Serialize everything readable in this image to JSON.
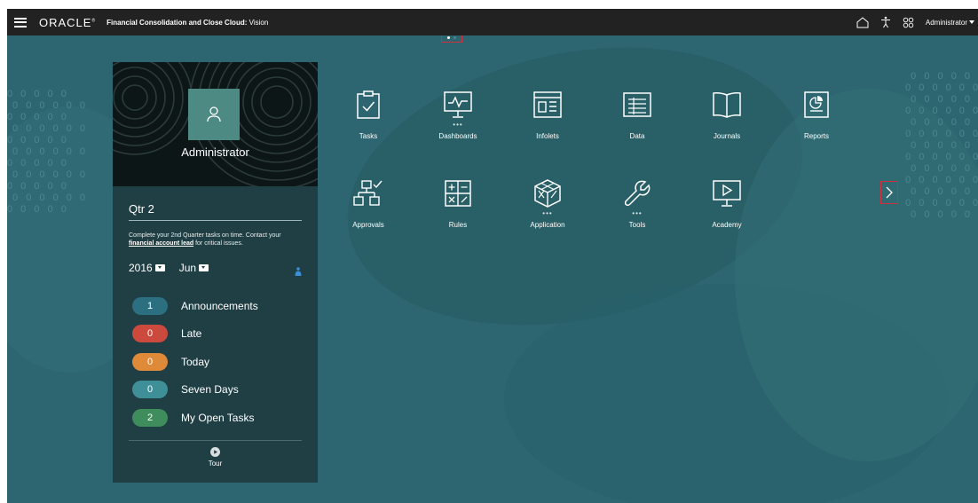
{
  "topbar": {
    "logo": "ORACLE",
    "app_title": "Financial Consolidation and Close Cloud:",
    "app_name": "Vision",
    "user": "Administrator"
  },
  "panel": {
    "user_name": "Administrator",
    "period_title": "Qtr 2",
    "description_prefix": "Complete your 2nd Quarter tasks on time. Contact your ",
    "description_link": "financial account lead",
    "description_suffix": " for critical issues.",
    "year": "2016",
    "month": "Jun",
    "status_items": [
      {
        "count": "1",
        "label": "Announcements",
        "color": "#2c6f80"
      },
      {
        "count": "0",
        "label": "Late",
        "color": "#cc4a3d"
      },
      {
        "count": "0",
        "label": "Today",
        "color": "#de8a39"
      },
      {
        "count": "0",
        "label": "Seven Days",
        "color": "#3f8f99"
      },
      {
        "count": "2",
        "label": "My Open Tasks",
        "color": "#3f8c5c"
      }
    ],
    "tour_label": "Tour"
  },
  "cards": [
    {
      "label": "Tasks",
      "icon": "tasks-icon"
    },
    {
      "label": "Dashboards",
      "icon": "dashboards-icon"
    },
    {
      "label": "Infolets",
      "icon": "infolets-icon"
    },
    {
      "label": "Data",
      "icon": "data-icon"
    },
    {
      "label": "Journals",
      "icon": "journals-icon"
    },
    {
      "label": "Reports",
      "icon": "reports-icon"
    },
    {
      "label": "Approvals",
      "icon": "approvals-icon"
    },
    {
      "label": "Rules",
      "icon": "rules-icon"
    },
    {
      "label": "Application",
      "icon": "application-icon"
    },
    {
      "label": "Tools",
      "icon": "tools-icon"
    },
    {
      "label": "Academy",
      "icon": "academy-icon"
    }
  ],
  "colors": {
    "topbar": "#222222",
    "background": "#2d6670",
    "panel": "#1f3f44",
    "highlight_border": "#d0303c"
  }
}
